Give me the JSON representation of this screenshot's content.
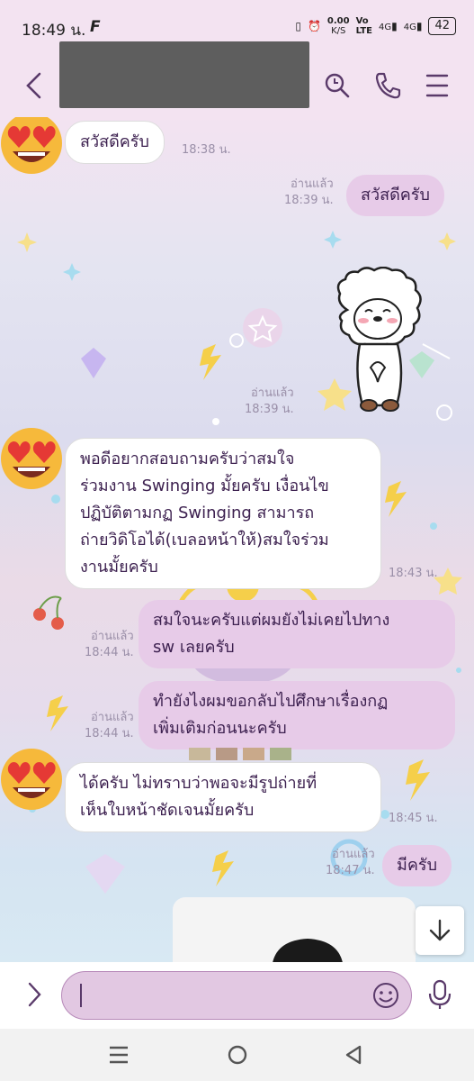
{
  "status_bar": {
    "time": "18:49 น.",
    "net_speed": "0.00",
    "net_unit": "K/S",
    "volte_1": "Vo",
    "volte_2": "LTE",
    "signal_1": "4G",
    "signal_2": "4G",
    "battery": "42"
  },
  "header": {
    "contact_name_redacted": true
  },
  "messages": [
    {
      "id": "m1",
      "side": "in",
      "text": "สวัสดีครับ",
      "time": "18:38 น."
    },
    {
      "id": "m2",
      "side": "out",
      "text": "สวัสดีครับ",
      "read": "อ่านแล้ว",
      "time": "18:39 น."
    },
    {
      "id": "m3",
      "side": "out",
      "type": "sticker",
      "read": "อ่านแล้ว",
      "time": "18:39 น."
    },
    {
      "id": "m4",
      "side": "in",
      "text": "พอดีอยากสอบถามครับว่าสมใจร่วมงาน Swinging มั้ยครับ เงื่อนไขปฏิบัติตามกฏ Swinging สามารถถ่ายวิดิโอได้(เบลอหน้าให้)สมใจร่วมงานมั้ยครับ",
      "time": "18:43 น."
    },
    {
      "id": "m5",
      "side": "out",
      "text": "สมใจนะครับแต่ผมยังไม่เคยไปทาง sw เลยครับ",
      "read": "อ่านแล้ว",
      "time": "18:44 น."
    },
    {
      "id": "m6",
      "side": "out",
      "text": "ทำยังไงผมขอกลับไปศึกษาเรื่องกฏเพิ่มเติมก่อนนะครับ",
      "read": "อ่านแล้ว",
      "time": "18:44 น."
    },
    {
      "id": "m7",
      "side": "in",
      "text": "ได้ครับ ไม่ทราบว่าพอจะมีรูปถ่ายที่เห็นใบหน้าชัดเจนมั้ยครับ",
      "time": "18:45 น."
    },
    {
      "id": "m8",
      "side": "out",
      "text": "มีครับ",
      "read": "อ่านแล้ว",
      "time": "18:47 น."
    }
  ],
  "lines": {
    "m4": [
      "พอดีอยากสอบถามครับว่าสมใจ",
      "ร่วมงาน Swinging มั้ยครับ เงื่อนไข",
      "ปฏิบัติตามกฏ Swinging สามารถ",
      "ถ่ายวิดิโอได้(เบลอหน้าให้)สมใจร่วม",
      "งานมั้ยครับ"
    ],
    "m5": [
      "สมใจนะครับแต่ผมยังไม่เคยไปทาง",
      "sw เลยครับ"
    ],
    "m6": [
      "ทำยังไงผมขอกลับไปศึกษาเรื่องกฏ",
      "เพิ่มเติมก่อนนะครับ"
    ],
    "m7": [
      "ได้ครับ ไม่ทราบว่าพอจะมีรูปถ่ายที่",
      "เห็นใบหน้าชัดเจนมั้ยครับ"
    ]
  },
  "icons": {
    "back": "chevron-left-icon",
    "search": "search-icon",
    "call": "phone-icon",
    "menu": "hamburger-menu-icon",
    "expand": "chevron-right-icon",
    "emoji": "smiley-icon",
    "mic": "microphone-icon",
    "scroll": "arrow-down-icon",
    "nav_recent": "recents-icon",
    "nav_home": "home-icon",
    "nav_back": "back-triangle-icon"
  },
  "colors": {
    "accent": "#5a3a6a",
    "bubble_out": "#e7cbe8",
    "bubble_in": "#ffffff",
    "header_bg": "#f3e3f1",
    "input_bg": "#e2c8e2"
  }
}
